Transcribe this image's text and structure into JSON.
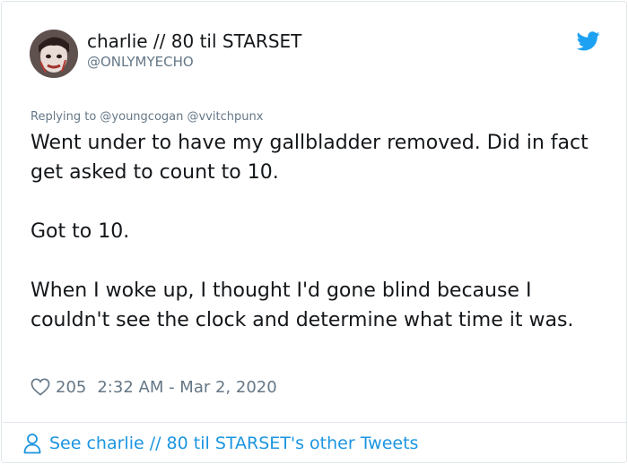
{
  "tweet": {
    "author": {
      "display_name": "charlie // 80 til STARSET",
      "handle": "@ONLYMYECHO",
      "avatar_icon": "avatar-image"
    },
    "brand_icon": "twitter-bird-icon",
    "reply_to": "Replying to @youngcogan @vvitchpunx",
    "paragraphs": [
      "Went under to have my gallbladder removed. Did in fact get asked to count to 10.",
      "Got to 10.",
      "When I woke up, I thought I'd gone blind because I couldn't see the clock and determine what time it was."
    ],
    "like_count": "205",
    "timestamp": "2:32 AM - Mar 2, 2020",
    "footer_link": "See charlie // 80 til STARSET's other Tweets"
  },
  "colors": {
    "accent": "#1da1f2",
    "link": "#1b95e0",
    "muted": "#657786",
    "text": "#14171a",
    "border": "#e1e8ed"
  }
}
